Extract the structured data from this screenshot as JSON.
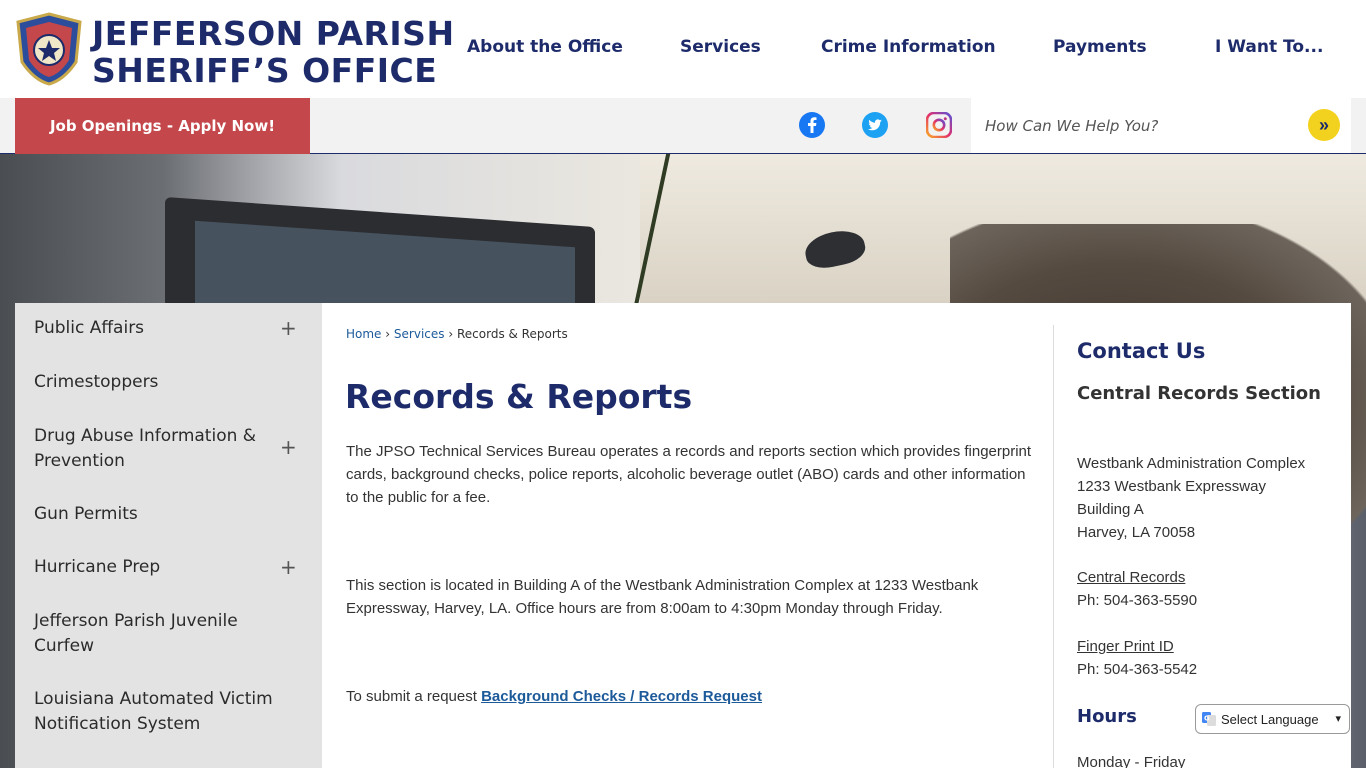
{
  "header": {
    "brand_line1": "JEFFERSON PARISH",
    "brand_line2": "SHERIFF’S OFFICE",
    "nav": [
      "About the Office",
      "Services",
      "Crime Information",
      "Payments",
      "I Want To..."
    ]
  },
  "subbar": {
    "jobs_label": "Job Openings - Apply Now!",
    "search_placeholder": "How Can We Help You?",
    "social_icons": [
      "facebook-icon",
      "twitter-icon",
      "instagram-icon"
    ],
    "colors": {
      "jobs": "#c4484b",
      "search_button": "#f3d21f",
      "brand": "#1d2b6b"
    }
  },
  "sidebar": {
    "items": [
      {
        "label": "Public Affairs",
        "expandable": true
      },
      {
        "label": "Crimestoppers",
        "expandable": false
      },
      {
        "label": "Drug Abuse Information & Prevention",
        "expandable": true
      },
      {
        "label": "Gun Permits",
        "expandable": false
      },
      {
        "label": "Hurricane Prep",
        "expandable": true
      },
      {
        "label": "Jefferson Parish Juvenile Curfew",
        "expandable": false
      },
      {
        "label": "Louisiana Automated Victim Notification System",
        "expandable": false
      }
    ],
    "plus": "+"
  },
  "breadcrumb": {
    "home": "Home",
    "services": "Services",
    "current": "Records & Reports",
    "sep": "›"
  },
  "main": {
    "title": "Records & Reports",
    "para1": "The JPSO Technical Services Bureau operates a records and reports section which provides fingerprint cards, background checks, police reports, alcoholic beverage outlet (ABO) cards and other information to the public for a fee.",
    "para2": "This section is located in Building A of the Westbank Administration Complex at 1233 Westbank Expressway, Harvey, LA.  Office hours are from 8:00am to 4:30pm Monday through Friday.",
    "request_prefix": "To submit a request ",
    "request_link": "Background Checks / Records Request"
  },
  "contact": {
    "title": "Contact Us",
    "section": "Central Records Section",
    "address": [
      "Westbank Administration Complex",
      "1233 Westbank Expressway",
      "Building A",
      "Harvey, LA 70058"
    ],
    "central_records_label": "Central Records",
    "central_records_phone": "Ph: 504-363-5590",
    "fingerprint_label": "Finger Print ID",
    "fingerprint_phone": "Ph: 504-363-5542",
    "hours_title": "Hours",
    "hours_line": "Monday - Friday"
  },
  "language": {
    "label": "Select Language"
  }
}
